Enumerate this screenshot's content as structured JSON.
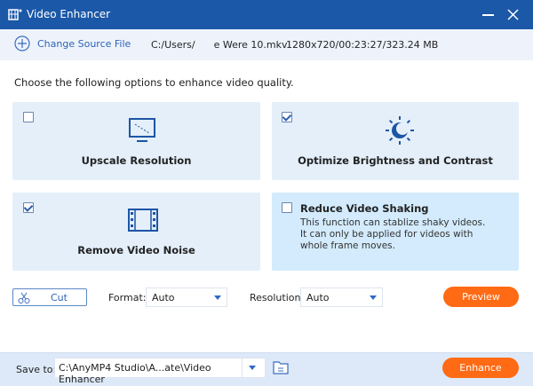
{
  "window": {
    "title": "Video Enhancer",
    "accent": "#1b58a8"
  },
  "source": {
    "change_label": "Change Source File",
    "path": "C:/Users/      e Were 10.mkv",
    "info": "1280x720/00:23:27/323.24 MB"
  },
  "instruction": "Choose the following options to enhance video quality.",
  "options": [
    {
      "label": "Upscale Resolution",
      "checked": false,
      "icon": "monitor-icon"
    },
    {
      "label": "Optimize Brightness and Contrast",
      "checked": true,
      "icon": "brightness-icon"
    },
    {
      "label": "Remove Video Noise",
      "checked": true,
      "icon": "film-icon"
    },
    {
      "label": "Reduce Video Shaking",
      "checked": false,
      "description": "This function can stablize shaky videos. It can only be applied for videos with whole frame moves."
    }
  ],
  "controls": {
    "cut_label": "Cut",
    "format_label": "Format:",
    "format_value": "Auto",
    "resolution_label": "Resolution:",
    "resolution_value": "Auto",
    "preview_label": "Preview"
  },
  "footer": {
    "save_label": "Save to:",
    "save_path": "C:\\AnyMP4 Studio\\A...ate\\Video Enhancer",
    "enhance_label": "Enhance"
  }
}
